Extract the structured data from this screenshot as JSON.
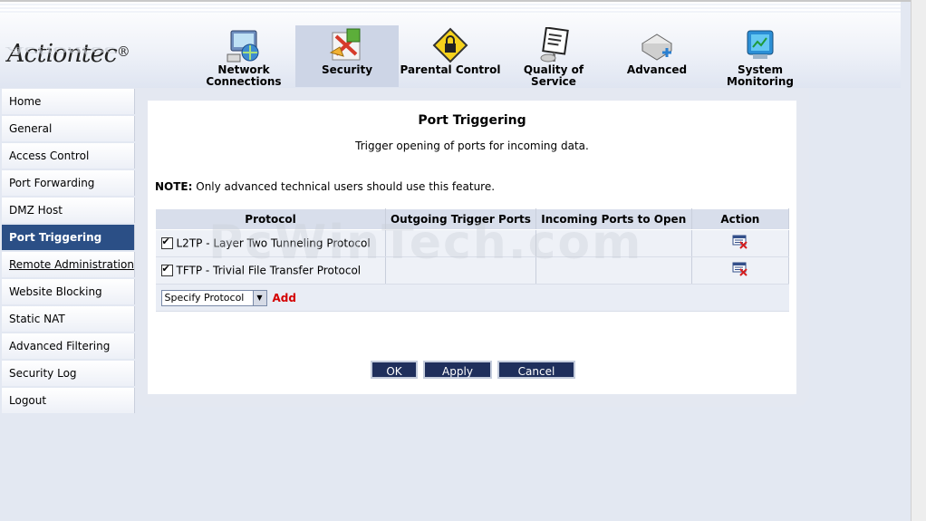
{
  "brand": {
    "logo_text": "Actiontec",
    "logo_mark": "®"
  },
  "nav_tabs": [
    {
      "label_line1": "Network",
      "label_line2": "Connections",
      "icon": "network-connections-icon"
    },
    {
      "label_line1": "Security",
      "label_line2": "",
      "icon": "security-icon",
      "active": true
    },
    {
      "label_line1": "Parental Control",
      "label_line2": "",
      "icon": "parental-control-icon"
    },
    {
      "label_line1": "Quality of",
      "label_line2": "Service",
      "icon": "quality-of-service-icon"
    },
    {
      "label_line1": "Advanced",
      "label_line2": "",
      "icon": "advanced-icon"
    },
    {
      "label_line1": "System",
      "label_line2": "Monitoring",
      "icon": "system-monitoring-icon"
    }
  ],
  "sidebar": {
    "items": [
      {
        "label": "Home"
      },
      {
        "label": "General"
      },
      {
        "label": "Access Control"
      },
      {
        "label": "Port Forwarding"
      },
      {
        "label": "DMZ Host"
      },
      {
        "label": "Port Triggering",
        "active": true
      },
      {
        "label": "Remote Administration"
      },
      {
        "label": "Website Blocking"
      },
      {
        "label": "Static NAT"
      },
      {
        "label": "Advanced Filtering"
      },
      {
        "label": "Security Log"
      },
      {
        "label": "Logout"
      }
    ]
  },
  "main": {
    "title": "Port Triggering",
    "subtitle": "Trigger opening of ports for incoming data.",
    "note_label": "NOTE:",
    "note_text": " Only advanced technical users should use this feature.",
    "table": {
      "columns": [
        "Protocol",
        "Outgoing Trigger Ports",
        "Incoming Ports to Open",
        "Action"
      ],
      "rows": [
        {
          "checked": true,
          "protocol": "L2TP - Layer Two Tunneling Protocol",
          "outgoing": "",
          "incoming": ""
        },
        {
          "checked": true,
          "protocol": "TFTP - Trivial File Transfer Protocol",
          "outgoing": "",
          "incoming": ""
        }
      ]
    },
    "add_select_value": "Specify Protocol",
    "add_label": "Add",
    "buttons": {
      "ok": "OK",
      "apply": "Apply",
      "cancel": "Cancel"
    }
  },
  "watermark": "PcWinTech.com",
  "colors": {
    "active_nav": "#2b4f86",
    "button": "#1f2f5c",
    "add_link": "#d40000"
  }
}
